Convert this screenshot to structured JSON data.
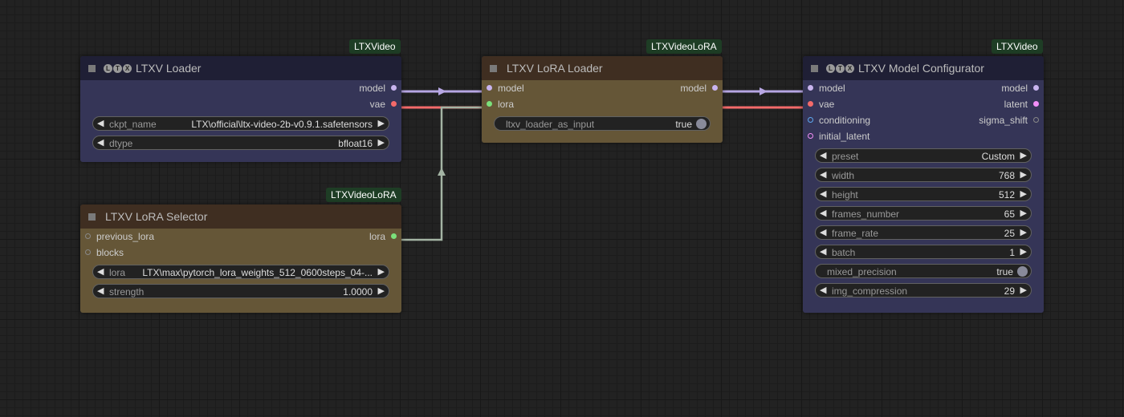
{
  "colors": {
    "model_wire": "#b7a6e3",
    "vae_wire": "#f46a6a",
    "lora_wire": "#a4b4a4",
    "model_dot": "#c8b4ee",
    "vae_dot": "#f46a6a",
    "lora_dot": "#7be07b",
    "conditioning_dot": "#5ea8f0",
    "latent_dot": "#f28ef7"
  },
  "nodes": {
    "loader": {
      "badge": "LTXVideo",
      "title": "LTXV Loader",
      "logo": [
        "L",
        "T",
        "X"
      ],
      "outputs": {
        "model": "model",
        "vae": "vae"
      },
      "widgets": {
        "ckpt_name": {
          "label": "ckpt_name",
          "value": "LTX\\official\\ltx-video-2b-v0.9.1.safetensors"
        },
        "dtype": {
          "label": "dtype",
          "value": "bfloat16"
        }
      }
    },
    "selector": {
      "badge": "LTXVideoLoRA",
      "title": "LTXV LoRA Selector",
      "inputs": {
        "previous_lora": "previous_lora",
        "blocks": "blocks"
      },
      "outputs": {
        "lora": "lora"
      },
      "widgets": {
        "lora": {
          "label": "lora",
          "value": "LTX\\max\\pytorch_lora_weights_512_0600steps_04-..."
        },
        "strength": {
          "label": "strength",
          "value": "1.0000"
        }
      }
    },
    "lora_loader": {
      "badge": "LTXVideoLoRA",
      "title": "LTXV LoRA Loader",
      "inputs": {
        "model": "model",
        "lora": "lora"
      },
      "outputs": {
        "model": "model"
      },
      "widgets": {
        "ltxv_loader_as_input": {
          "label": "ltxv_loader_as_input",
          "value": "true"
        }
      }
    },
    "configurator": {
      "badge": "LTXVideo",
      "title": "LTXV Model Configurator",
      "logo": [
        "L",
        "T",
        "X"
      ],
      "inputs": {
        "model": "model",
        "vae": "vae",
        "conditioning": "conditioning",
        "initial_latent": "initial_latent"
      },
      "outputs": {
        "model": "model",
        "latent": "latent",
        "sigma_shift": "sigma_shift"
      },
      "widgets": {
        "preset": {
          "label": "preset",
          "value": "Custom"
        },
        "width": {
          "label": "width",
          "value": "768"
        },
        "height": {
          "label": "height",
          "value": "512"
        },
        "frames_number": {
          "label": "frames_number",
          "value": "65"
        },
        "frame_rate": {
          "label": "frame_rate",
          "value": "25"
        },
        "batch": {
          "label": "batch",
          "value": "1"
        },
        "mixed_precision": {
          "label": "mixed_precision",
          "value": "true"
        },
        "img_compression": {
          "label": "img_compression",
          "value": "29"
        }
      }
    }
  }
}
